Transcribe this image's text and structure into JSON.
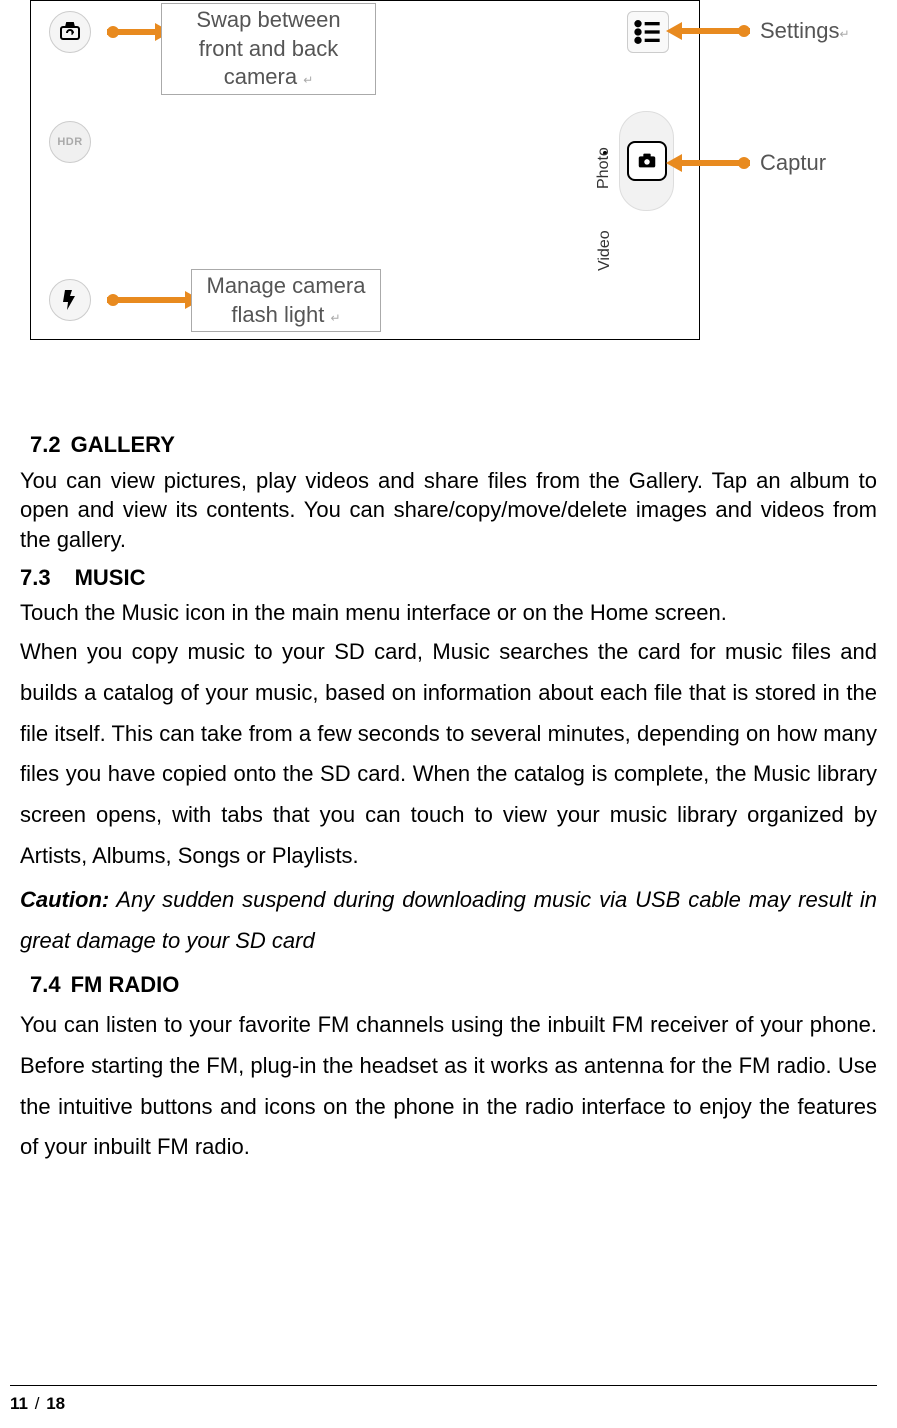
{
  "figure": {
    "swap_callout": "Swap between front and back camera",
    "flash_callout": "Manage camera flash light",
    "settings_label": "Settings",
    "capture_label": "Captur",
    "hdr_label": "HDR",
    "photo_label": "Photo",
    "video_label": "Video"
  },
  "sections": {
    "s72_num": "7.2",
    "s72_title": "GALLERY",
    "s72_body": "You can view pictures, play videos and share files from the Gallery. Tap an album to open and view its contents. You can share/copy/move/delete images and videos from the gallery.",
    "s73_num": "7.3",
    "s73_title": "MUSIC",
    "s73_body1": "Touch the Music icon in the main menu interface or on the Home screen.",
    "s73_body2": "When you copy music to your SD card, Music searches the card for music files and builds a catalog of your music, based on information about each file that is stored in the file itself. This can take from a few seconds to several minutes, depending on how many files you have copied onto the SD card. When the catalog is complete, the Music library screen opens, with tabs that you can touch to view your music library organized by Artists, Albums, Songs or Playlists.",
    "s73_caution_label": "Caution:",
    "s73_caution_body": " Any sudden suspend during downloading music via USB cable may result in great damage to your SD card",
    "s74_num": "7.4",
    "s74_title": "FM RADIO",
    "s74_body": "You can listen to your favorite FM channels using the inbuilt FM receiver of your phone. Before starting the FM, plug-in the headset as it works as antenna for the FM radio. Use the intuitive buttons and icons on the phone in the radio interface to enjoy the features of your inbuilt FM radio."
  },
  "footer": {
    "current": "11",
    "sep": "/",
    "total": "18"
  }
}
